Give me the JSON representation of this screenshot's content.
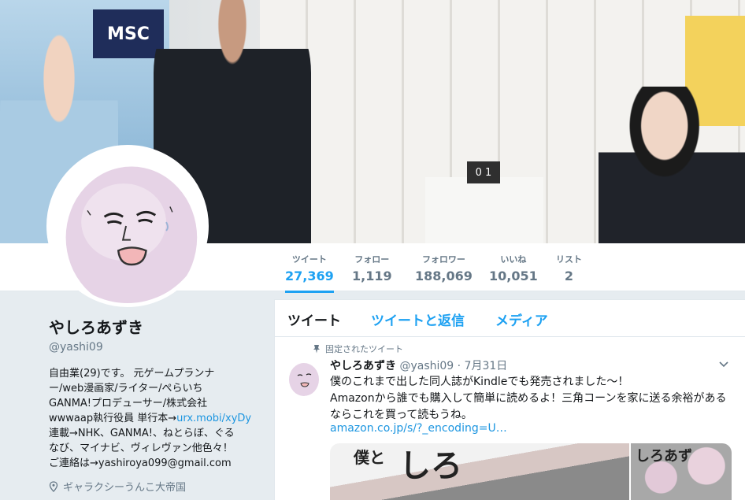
{
  "profile": {
    "name": "やしろあずき",
    "handle": "@yashi09",
    "bio_lines": [
      "自由業(29)です。 元ゲームプランナ",
      "ー/web漫画家/ライター/ぺらいち",
      "GANMA!プロデューサー/株式会社",
      "wwwaap執行役員 単行本→",
      "連載→NHK、GANMA!、ねとらぼ、ぐる",
      "なび、マイナビ、ヴィレヴァン他色々！",
      "ご連絡は→yashiroya099@gmail.com"
    ],
    "bio_link": "urx.mobi/xyDy",
    "location": "ギャラクシーうんこ大帝国"
  },
  "banner": {
    "sign_text": "MSC",
    "cube_text": "0 1"
  },
  "stats": [
    {
      "label": "ツイート",
      "value": "27,369"
    },
    {
      "label": "フォロー",
      "value": "1,119"
    },
    {
      "label": "フォロワー",
      "value": "188,069"
    },
    {
      "label": "いいね",
      "value": "10,051"
    },
    {
      "label": "リスト",
      "value": "2"
    }
  ],
  "timeline": {
    "tabs": [
      "ツイート",
      "ツイートと返信",
      "メディア"
    ],
    "pinned_label": "固定されたツイート",
    "tweet": {
      "name": "やしろあずき",
      "handle": "@yashi09",
      "date": "· 7月31日",
      "line1": "僕のこれまで出した同人誌がKindleでも発売されました〜！",
      "line2": "Amazonから誰でも購入して簡単に読めるよ！三角コーンを家に送る余裕がある",
      "line3": "ならこれを買って読もうね。",
      "link": "amazon.co.jp/s/?_encoding=U…",
      "media_text_1": "しろ",
      "media_text_2": "僕と",
      "media_text_3": "しろあず"
    }
  },
  "colors": {
    "accent": "#1da1f2",
    "link": "#1b95e0"
  }
}
